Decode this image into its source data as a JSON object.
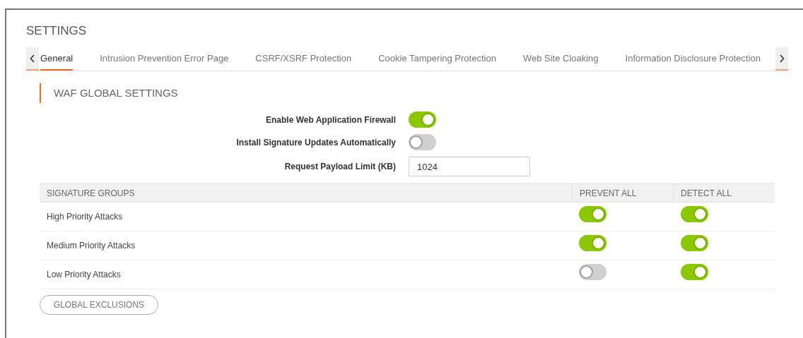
{
  "page": {
    "title": "SETTINGS"
  },
  "tabs": [
    {
      "label": "General",
      "selected": true
    },
    {
      "label": "Intrusion Prevention Error Page",
      "selected": false
    },
    {
      "label": "CSRF/XSRF Protection",
      "selected": false
    },
    {
      "label": "Cookie Tampering Protection",
      "selected": false
    },
    {
      "label": "Web Site Cloaking",
      "selected": false
    },
    {
      "label": "Information Disclosure Protection",
      "selected": false
    }
  ],
  "section": {
    "title": "WAF GLOBAL SETTINGS"
  },
  "settings": [
    {
      "kind": "toggle",
      "label": "Enable Web Application Firewall",
      "on": true
    },
    {
      "kind": "toggle",
      "label": "Install Signature Updates Automatically",
      "on": false
    },
    {
      "kind": "input",
      "label": "Request Payload Limit (KB)",
      "value": "1024"
    }
  ],
  "table": {
    "columns": [
      "SIGNATURE GROUPS",
      "PREVENT ALL",
      "DETECT ALL"
    ],
    "rows": [
      {
        "name": "High Priority Attacks",
        "prevent": true,
        "detect": true
      },
      {
        "name": "Medium Priority Attacks",
        "prevent": true,
        "detect": true
      },
      {
        "name": "Low Priority Attacks",
        "prevent": false,
        "detect": true
      }
    ]
  },
  "buttons": [
    "GLOBAL EXCLUSIONS"
  ]
}
